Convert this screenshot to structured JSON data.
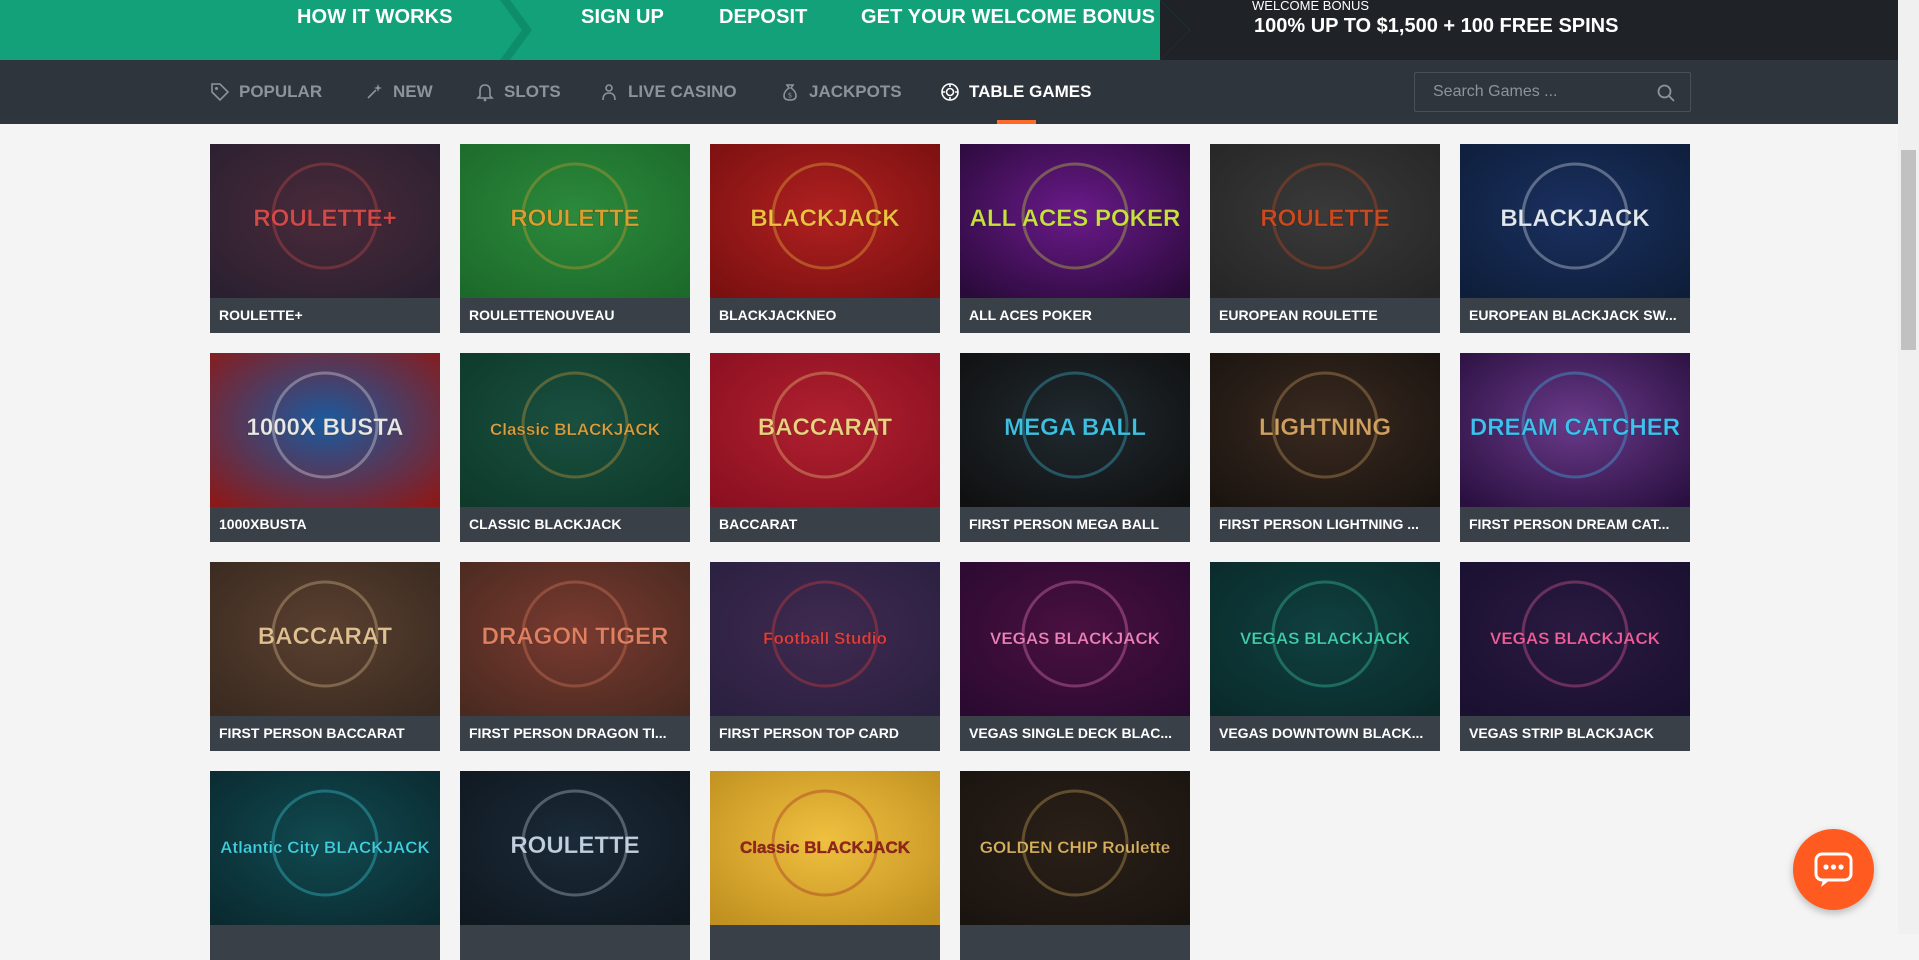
{
  "banner": {
    "links": [
      "HOW IT WORKS",
      "SIGN UP",
      "DEPOSIT",
      "GET YOUR WELCOME BONUS"
    ],
    "bonus_label": "WELCOME BONUS",
    "bonus_offer": "100% UP TO $1,500 + 100 FREE SPINS"
  },
  "nav": {
    "categories": [
      {
        "label": "POPULAR",
        "icon": "tag-icon"
      },
      {
        "label": "NEW",
        "icon": "sparkle-icon"
      },
      {
        "label": "SLOTS",
        "icon": "bell-icon"
      },
      {
        "label": "LIVE CASINO",
        "icon": "dealer-icon"
      },
      {
        "label": "JACKPOTS",
        "icon": "money-bag-icon"
      },
      {
        "label": "TABLE GAMES",
        "icon": "chip-icon"
      }
    ],
    "active_category": "TABLE GAMES",
    "search_placeholder": "Search Games ..."
  },
  "games": [
    {
      "title": "ROULETTE+",
      "art": "ROULETTE+"
    },
    {
      "title": "ROULETTENOUVEAU",
      "art": "ROULETTE"
    },
    {
      "title": "BLACKJACKNEO",
      "art": "BLACKJACK"
    },
    {
      "title": "ALL ACES POKER",
      "art": "ALL ACES POKER"
    },
    {
      "title": "EUROPEAN ROULETTE",
      "art": "ROULETTE"
    },
    {
      "title": "EUROPEAN BLACKJACK SW...",
      "art": "BLACKJACK"
    },
    {
      "title": "1000XBUSTA",
      "art": "1000X BUSTA"
    },
    {
      "title": "CLASSIC BLACKJACK",
      "art": "Classic BLACKJACK"
    },
    {
      "title": "BACCARAT",
      "art": "BACCARAT"
    },
    {
      "title": "FIRST PERSON MEGA BALL",
      "art": "MEGA BALL"
    },
    {
      "title": "FIRST PERSON LIGHTNING ...",
      "art": "LIGHTNING"
    },
    {
      "title": "FIRST PERSON DREAM CAT...",
      "art": "DREAM CATCHER"
    },
    {
      "title": "FIRST PERSON BACCARAT",
      "art": "BACCARAT"
    },
    {
      "title": "FIRST PERSON DRAGON TI...",
      "art": "DRAGON TIGER"
    },
    {
      "title": "FIRST PERSON TOP CARD",
      "art": "Football Studio"
    },
    {
      "title": "VEGAS SINGLE DECK BLAC...",
      "art": "VEGAS BLACKJACK"
    },
    {
      "title": "VEGAS DOWNTOWN BLACK...",
      "art": "VEGAS BLACKJACK"
    },
    {
      "title": "VEGAS STRIP BLACKJACK",
      "art": "VEGAS BLACKJACK"
    },
    {
      "title": "",
      "art": "Atlantic City BLACKJACK"
    },
    {
      "title": "",
      "art": "ROULETTE"
    },
    {
      "title": "",
      "art": "Classic BLACKJACK"
    },
    {
      "title": "",
      "art": "GOLDEN CHIP Roulette"
    }
  ],
  "colors": {
    "banner_green": "#12a179",
    "banner_dark": "#1f2327",
    "nav_bg": "#2f353c",
    "active_underline": "#ff6a2b",
    "caption_bg": "#3a4048",
    "chat_orange": "#ff5a1f"
  }
}
